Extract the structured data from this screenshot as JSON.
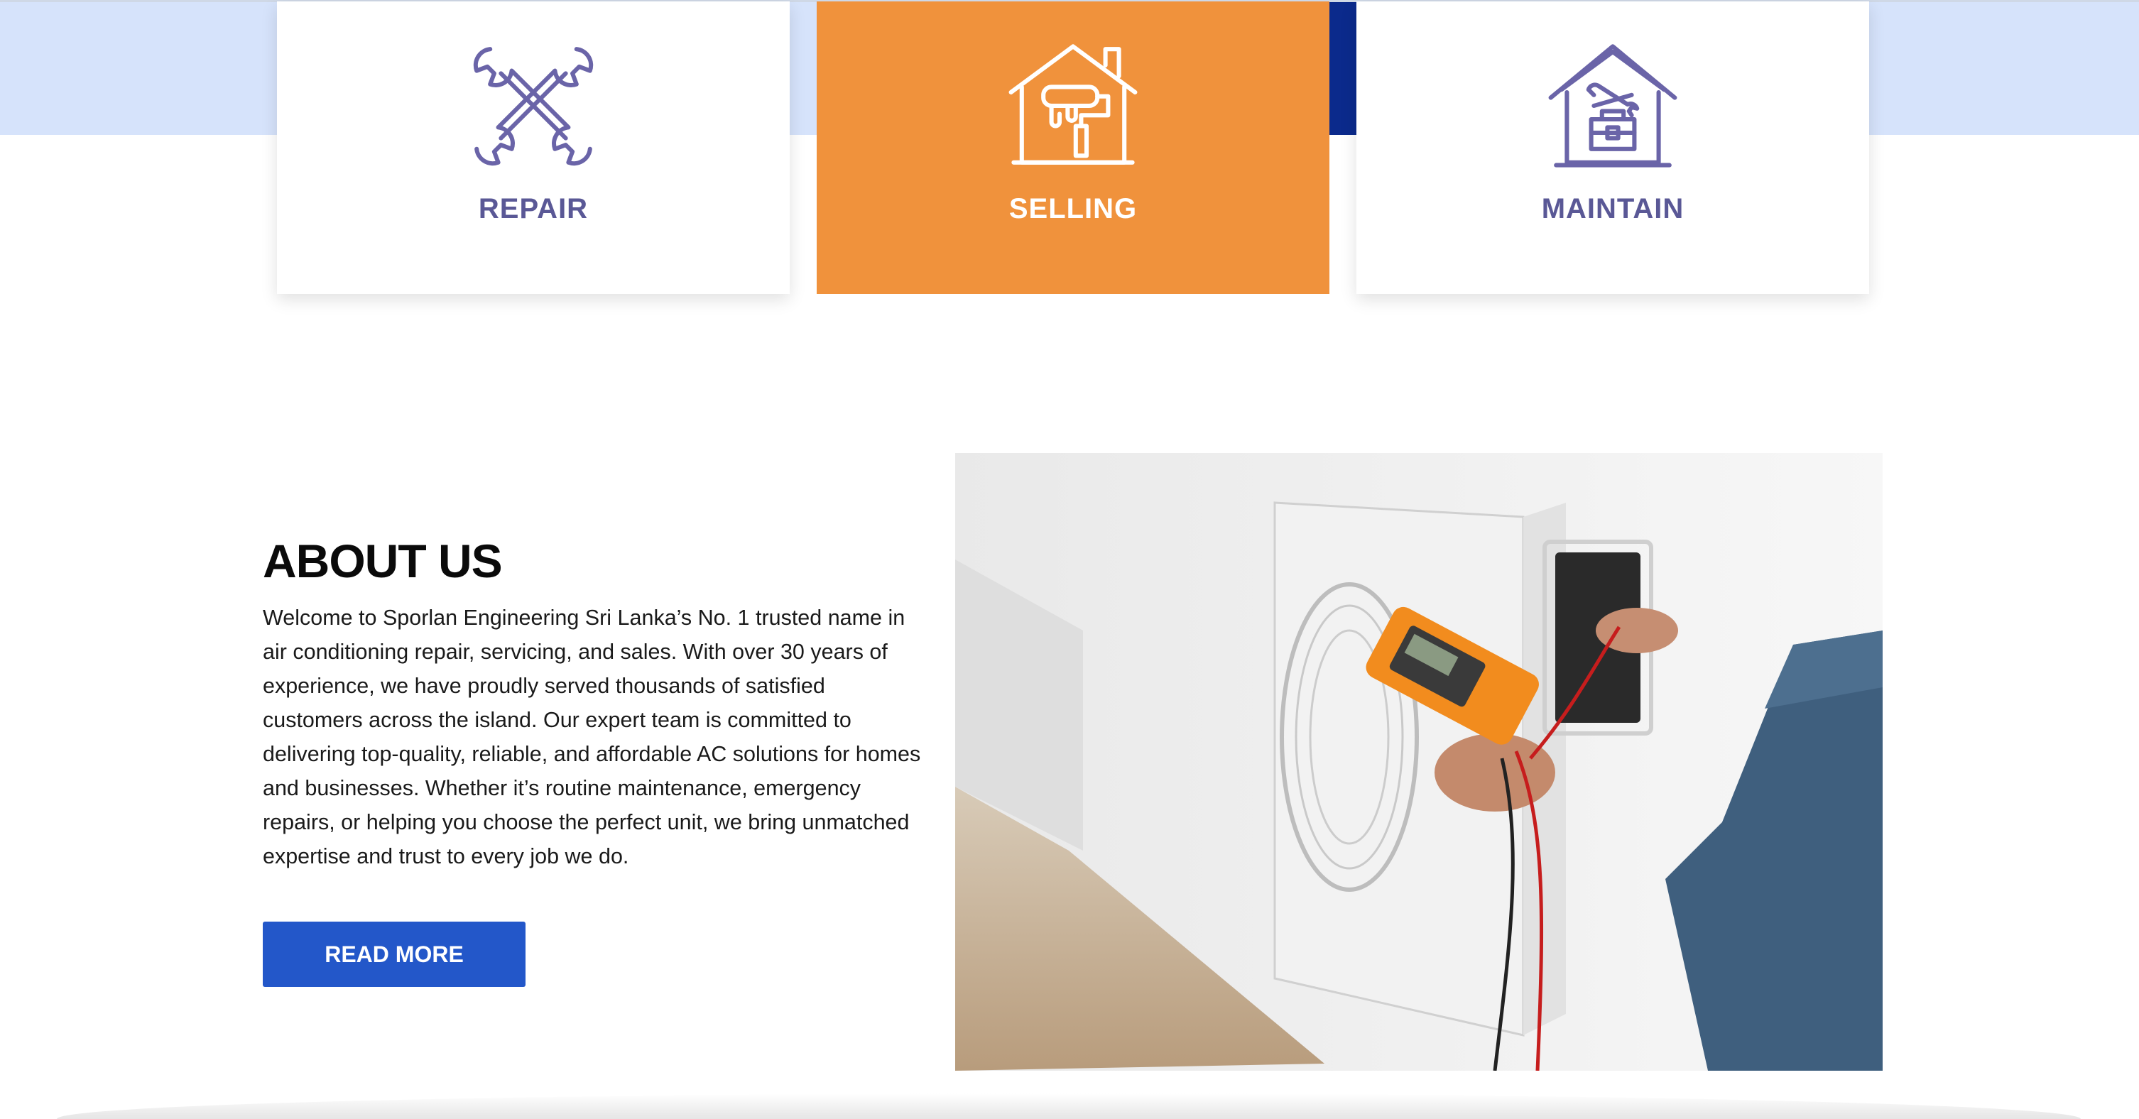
{
  "services": {
    "repair": {
      "label": "REPAIR",
      "icon": "wrench-cross-icon"
    },
    "selling": {
      "label": "SELLING",
      "icon": "house-paint-icon"
    },
    "maintain": {
      "label": "MAINTAIN",
      "icon": "house-toolbox-icon"
    }
  },
  "about": {
    "title": "ABOUT US",
    "body": "Welcome to Sporlan Engineering Sri Lanka’s No. 1 trusted name in air conditioning repair, servicing, and sales. With over 30 years of experience, we have proudly served thousands of satisfied customers across the island. Our expert team is committed to delivering top-quality, reliable, and affordable AC solutions for homes and businesses. Whether it’s routine maintenance, emergency repairs, or helping you choose the perfect unit, we bring unmatched expertise and trust to every job we do.",
    "button_label": "READ MORE"
  },
  "colors": {
    "accent_orange": "#f0923c",
    "icon_purple": "#6a64a8",
    "button_blue": "#2357c9",
    "band_blue": "#d6e3fb"
  }
}
